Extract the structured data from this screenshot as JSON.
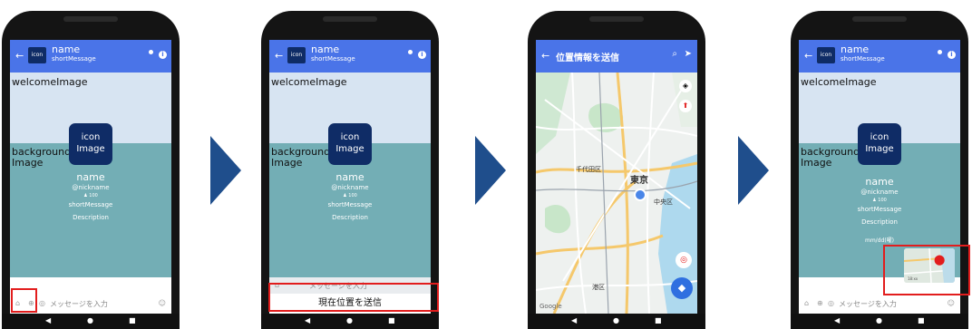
{
  "profile": {
    "icon_label": "icon",
    "name": "name",
    "short_message": "shortMessage",
    "welcome_image_label": "welcomeImage",
    "background_image_label": "background\nImage",
    "icon_image_label": "icon\nImage",
    "nickname": "@nickname",
    "count": "♟ 100",
    "description": "Description"
  },
  "input": {
    "placeholder": "メッセージを入力"
  },
  "screen2": {
    "send_location_button": "現在位置を送信"
  },
  "screen3": {
    "title": "位置情報を送信",
    "map_labels": {
      "tokyo": "東京",
      "chuo": "中央区",
      "chiyoda": "千代田区",
      "minato": "港区",
      "google": "Google"
    }
  },
  "screen4": {
    "date": "mm/dd(曜)",
    "map_time": "18:xx"
  },
  "colors": {
    "header": "#4a74e8",
    "icon_bg": "#0f2c66",
    "welcome_bg": "#d7e4f2",
    "background_bg": "#73aeb5",
    "highlight": "#e21d1d",
    "arrow": "#1f4e8c"
  }
}
